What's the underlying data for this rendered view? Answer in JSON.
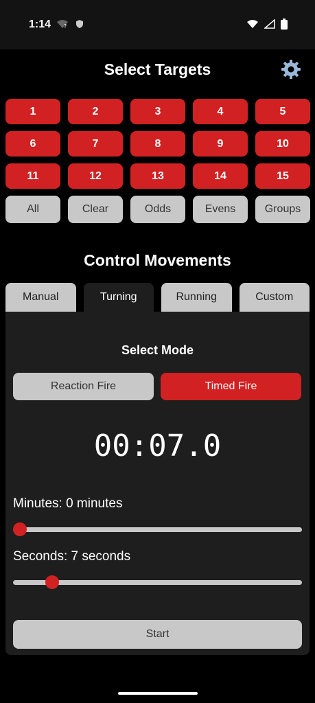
{
  "status": {
    "time": "1:14",
    "icons_left": [
      "wifi-question-icon",
      "shield-icon"
    ],
    "icons_right": [
      "wifi-icon",
      "cell-signal-icon",
      "battery-icon"
    ]
  },
  "header": {
    "title": "Select Targets",
    "settings_icon": "gear-icon"
  },
  "targets": [
    "1",
    "2",
    "3",
    "4",
    "5",
    "6",
    "7",
    "8",
    "9",
    "10",
    "11",
    "12",
    "13",
    "14",
    "15"
  ],
  "target_actions": [
    "All",
    "Clear",
    "Odds",
    "Evens",
    "Groups"
  ],
  "section_title": "Control Movements",
  "tabs": [
    "Manual",
    "Turning",
    "Running",
    "Custom"
  ],
  "active_tab": "Turning",
  "mode": {
    "label": "Select Mode",
    "options": [
      "Reaction Fire",
      "Timed Fire"
    ],
    "selected": "Timed Fire"
  },
  "timer": "00:07.0",
  "minutes_slider": {
    "label": "Minutes:  0 minutes",
    "value": 0
  },
  "seconds_slider": {
    "label": "Seconds:  7 seconds",
    "value": 7
  },
  "start_label": "Start",
  "colors": {
    "accent": "#d22122",
    "button_gray": "#c8c8c8",
    "panel": "#1e1e1e"
  }
}
